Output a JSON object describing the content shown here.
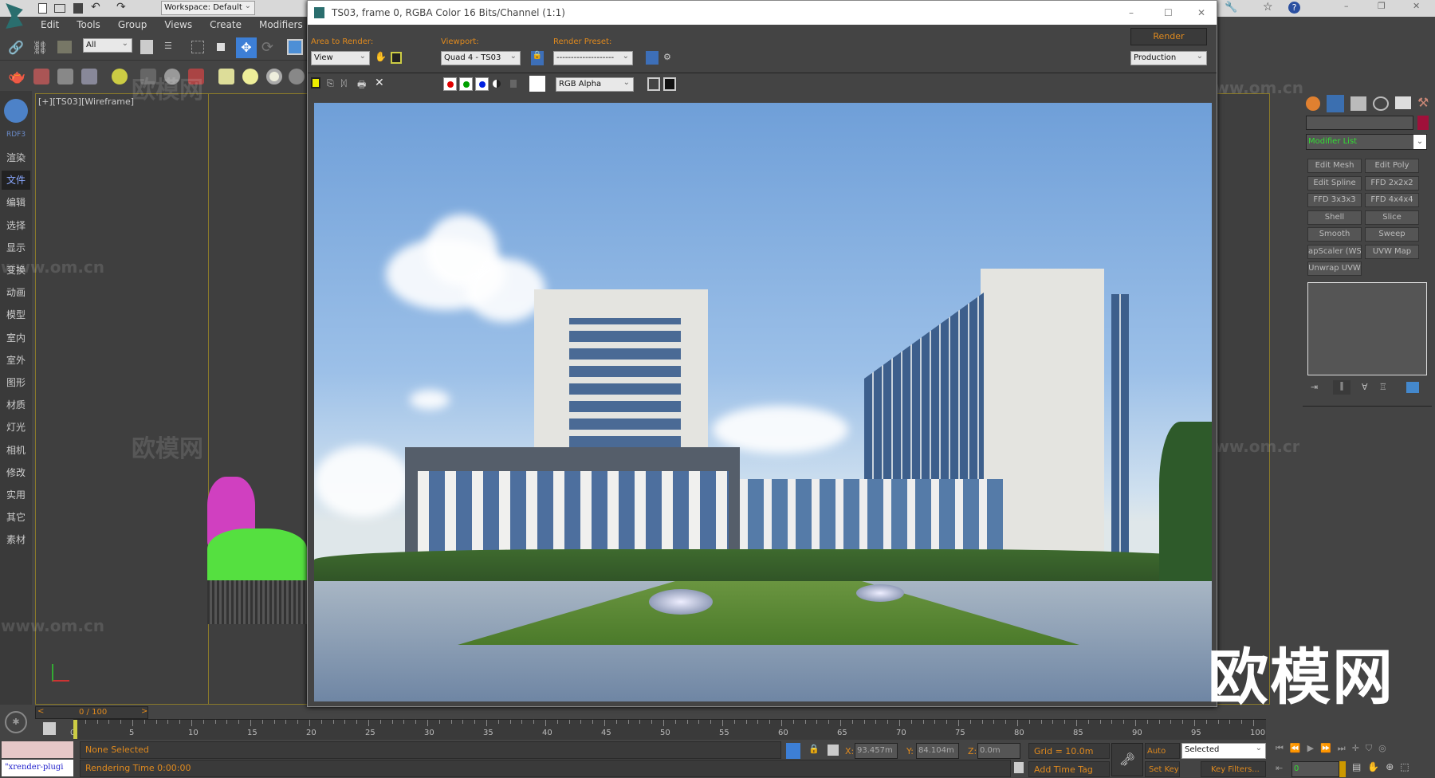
{
  "app": {
    "workspace": "Workspace: Default",
    "menu": [
      "Edit",
      "Tools",
      "Group",
      "Views",
      "Create",
      "Modifiers"
    ],
    "selection_filter": "All"
  },
  "sidebar": {
    "logo_label": "RDF3",
    "items": [
      "渲染",
      "文件",
      "编辑",
      "选择",
      "显示",
      "变换",
      "动画",
      "模型",
      "室内",
      "室外",
      "图形",
      "材质",
      "灯光",
      "相机",
      "修改",
      "实用",
      "其它",
      "素材"
    ],
    "active": "文件"
  },
  "viewport": {
    "label": "[+][TS03][Wireframe]"
  },
  "render_window": {
    "title": "TS03, frame 0, RGBA Color 16 Bits/Channel (1:1)",
    "area_label": "Area to Render:",
    "area_value": "View",
    "viewport_label": "Viewport:",
    "viewport_value": "Quad 4 - TS03",
    "preset_label": "Render Preset:",
    "preset_value": "--------------------",
    "render_button": "Render",
    "mode_value": "Production",
    "channel_value": "RGB Alpha",
    "colors": {
      "red": "#e00000",
      "green": "#00a000",
      "blue": "#0020e0"
    }
  },
  "command_panel": {
    "modifier_list": "Modifier List",
    "modifier_color": "#a0103a",
    "buttons": [
      "Edit Mesh",
      "Edit Poly",
      "Edit Spline",
      "FFD 2x2x2",
      "FFD 3x3x3",
      "FFD 4x4x4",
      "Shell",
      "Slice",
      "Smooth",
      "Sweep",
      "apScaler (WSM",
      "UVW Map",
      "Unwrap UVW"
    ]
  },
  "timeline": {
    "frame": "0 / 100",
    "ticks": [
      "0",
      "5",
      "10",
      "15",
      "20",
      "25",
      "30",
      "35",
      "40",
      "45",
      "50",
      "55",
      "60",
      "65",
      "70",
      "75",
      "80",
      "85",
      "90",
      "95",
      "100"
    ]
  },
  "status": {
    "selection": "None Selected",
    "render_time": "Rendering Time  0:00:00",
    "script": "\"xrender-plugi",
    "x_label": "X:",
    "x": "93.457m",
    "y_label": "Y:",
    "y": "84.104m",
    "z_label": "Z:",
    "z": "0.0m",
    "grid": "Grid = 10.0m",
    "add_time_tag": "Add Time Tag",
    "auto_key": "Auto Key",
    "set_key": "Set Key",
    "key_mode": "Selected",
    "key_filters": "Key Filters...",
    "current_frame": "0"
  },
  "watermark": {
    "cn": "欧模网",
    "url": "www.om.cn"
  }
}
